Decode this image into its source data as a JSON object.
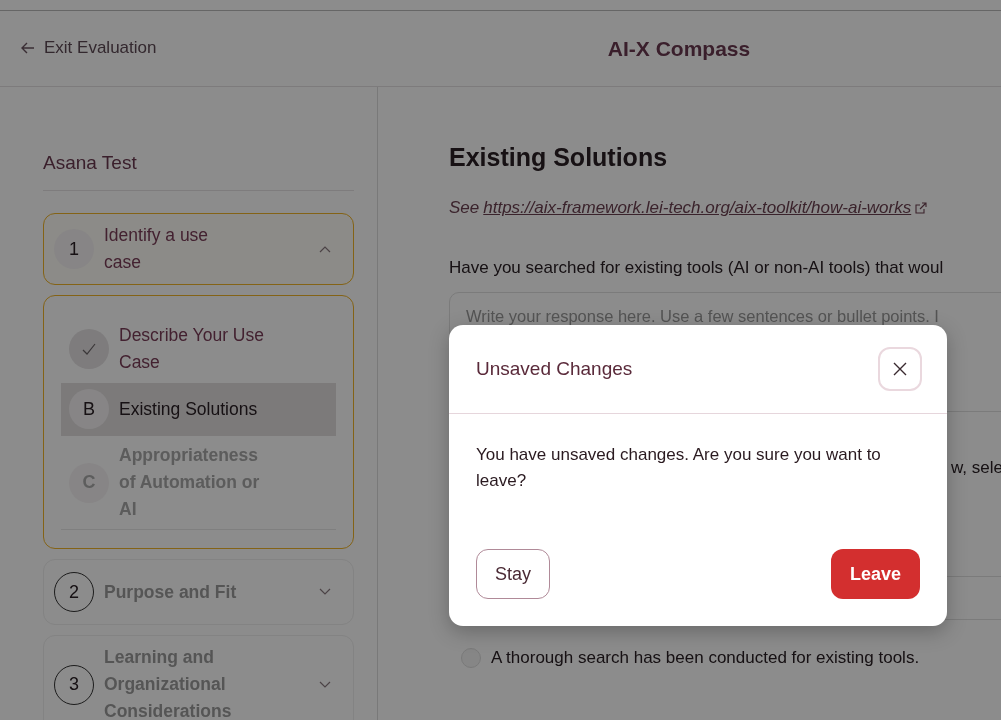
{
  "header": {
    "back_link": "Exit Evaluation",
    "title": "AI-X Compass"
  },
  "sidebar": {
    "project": "Asana Test",
    "sections": [
      {
        "number": "1",
        "title": "Identify a use case",
        "expanded": true,
        "disabled": false,
        "steps": [
          {
            "label": "Describe Your Use Case",
            "completed": true,
            "selected": false,
            "disabled": false
          },
          {
            "badge": "B",
            "label": "Existing Solutions",
            "completed": false,
            "selected": true,
            "disabled": false
          },
          {
            "badge": "C",
            "label": "Appropriateness of Automation or AI",
            "completed": false,
            "selected": false,
            "disabled": true
          }
        ]
      },
      {
        "number": "2",
        "title": "Purpose and Fit",
        "expanded": false,
        "disabled": true
      },
      {
        "number": "3",
        "title": "Learning and Organizational Considerations",
        "expanded": false,
        "disabled": true
      }
    ]
  },
  "main": {
    "heading": "Existing Solutions",
    "reference": {
      "prefix": "See",
      "link": "https://aix-framework.lei-tech.org/aix-toolkit/how-ai-works"
    },
    "question": "Have you searched for existing tools (AI or non-AI tools) that woul",
    "answer": {
      "placeholder": "Write your response here. Use a few sentences or bullet points. I"
    },
    "question_2": "w, sele",
    "option": {
      "label": "A thorough search has been conducted for existing tools.",
      "checked": false
    }
  },
  "modal": {
    "title": "Unsaved Changes",
    "message": "You have unsaved changes. Are you sure you want to leave?",
    "buttons": [
      {
        "label": "Stay",
        "kind": "secondary"
      },
      {
        "label": "Leave",
        "kind": "danger"
      }
    ]
  }
}
